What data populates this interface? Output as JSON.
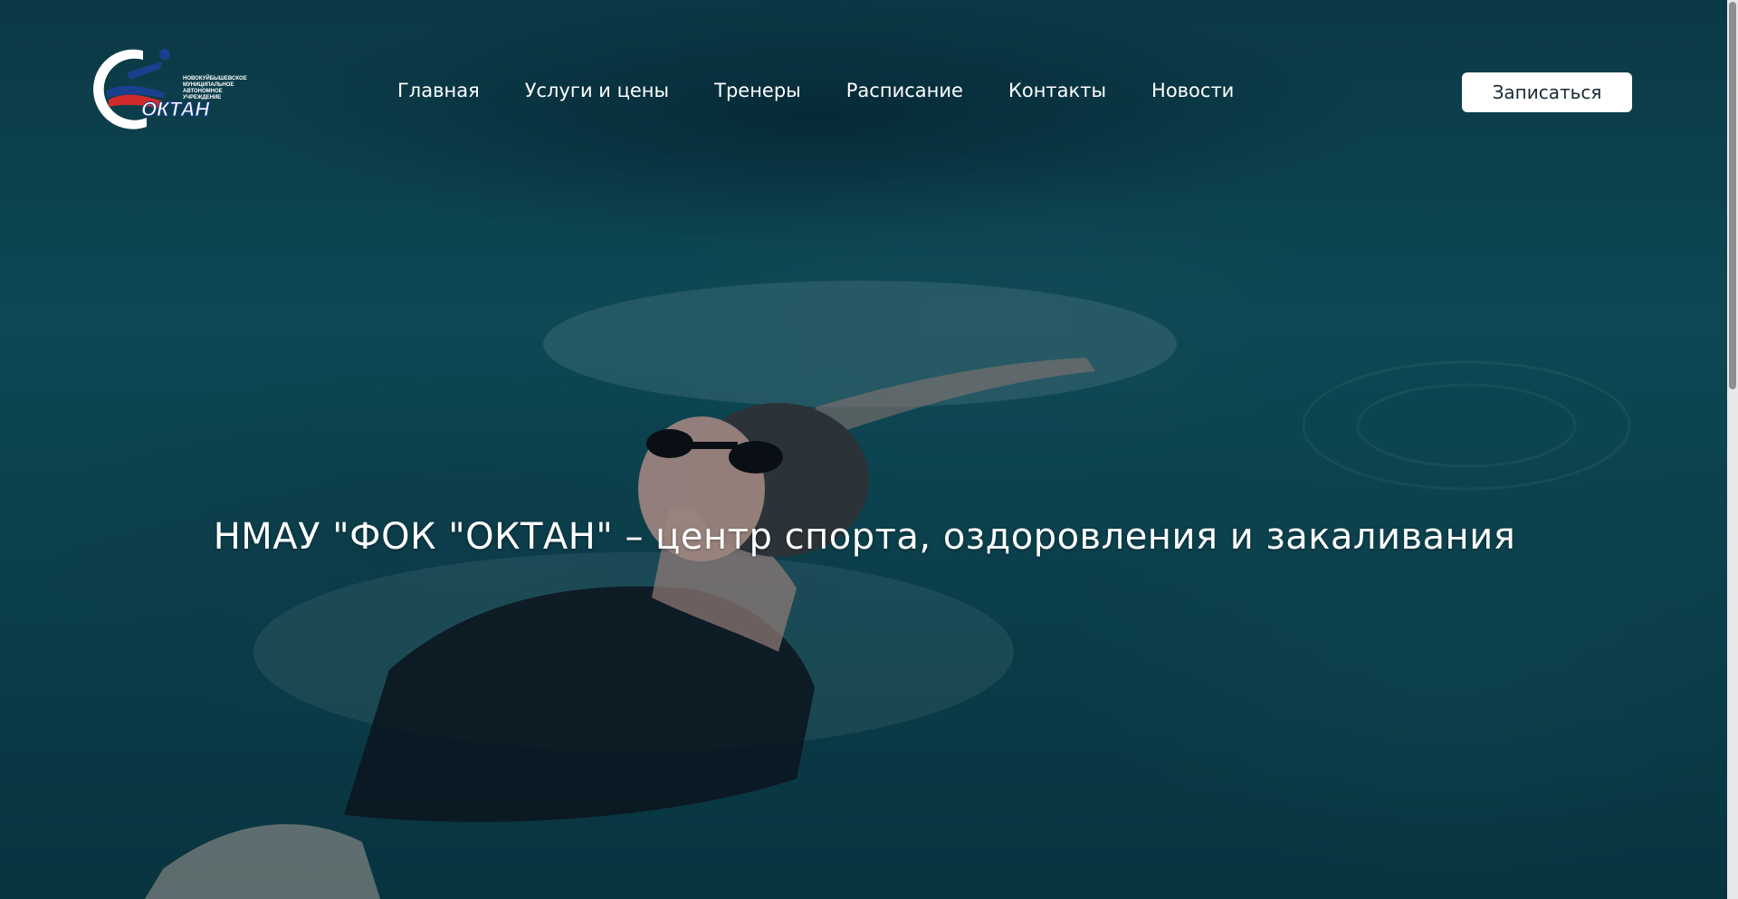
{
  "brand": {
    "logo_caption": "НОВОКУЙБЫШЕВСКОЕ МУНИЦИПАЛЬНОЕ АВТОНОМНОЕ УЧРЕЖДЕНИЕ",
    "logo_name": "ОКТАН",
    "colors": {
      "logo_blue": "#1a3f8f",
      "logo_red": "#d22a2a",
      "logo_white": "#ffffff"
    }
  },
  "nav": {
    "items": [
      {
        "label": "Главная"
      },
      {
        "label": "Услуги и цены"
      },
      {
        "label": "Тренеры"
      },
      {
        "label": "Расписание"
      },
      {
        "label": "Контакты"
      },
      {
        "label": "Новости"
      }
    ],
    "cta_label": "Записаться"
  },
  "hero": {
    "title": "НМАУ \"ФОК \"ОКТАН\" – центр спорта, оздоровления и закаливания",
    "background_image": "swimmer-in-pool-photo"
  },
  "colors": {
    "text": "#ffffff",
    "button_bg": "#ffffff",
    "button_text": "#1a2a33",
    "water": "#125a66"
  }
}
